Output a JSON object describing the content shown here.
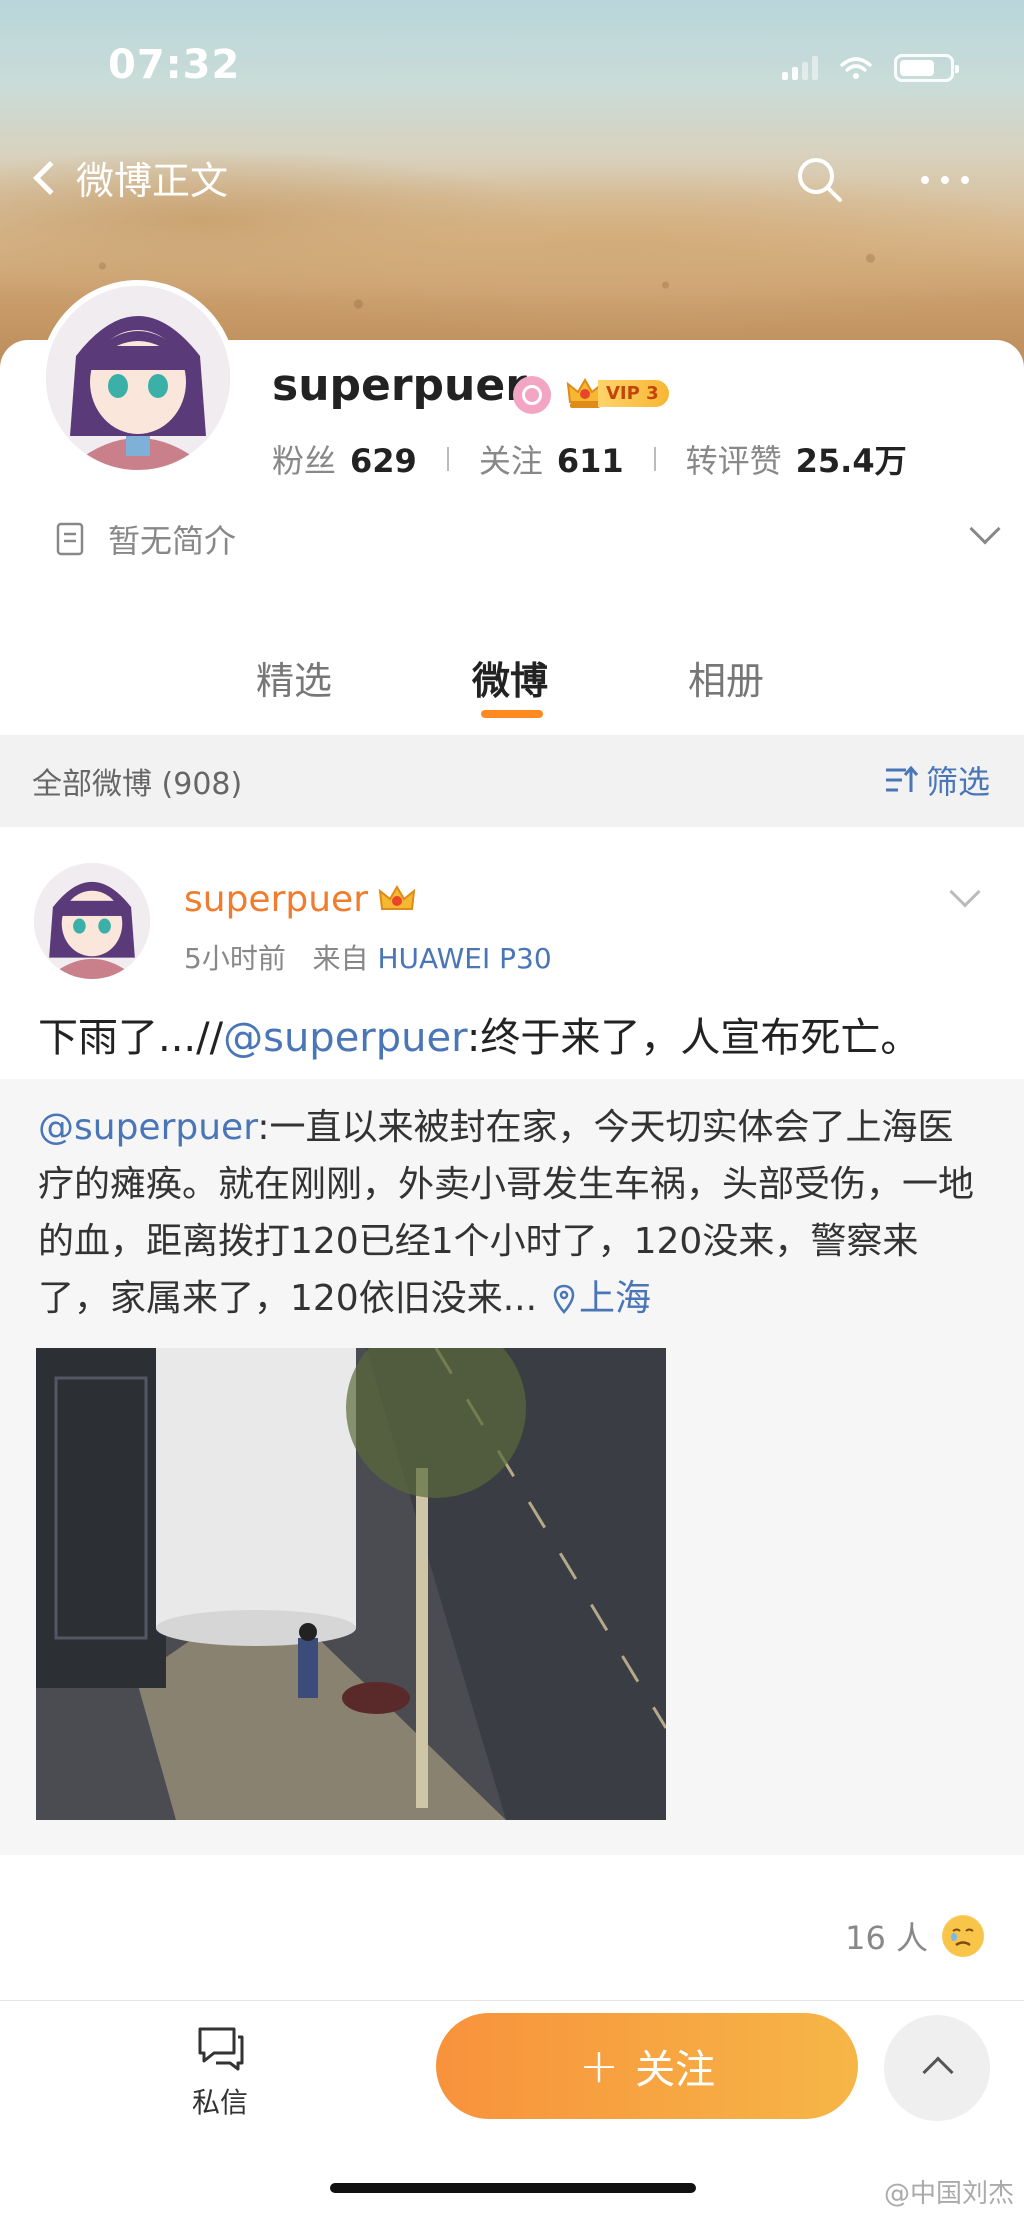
{
  "status_bar": {
    "time": "07:32",
    "battery_level": 0.7
  },
  "nav": {
    "back_label": "微博正文"
  },
  "profile": {
    "username": "superpuer",
    "vip_label": "VIP 3",
    "followers_label": "粉丝",
    "followers": "629",
    "following_label": "关注",
    "following": "611",
    "engagement_label": "转评赞",
    "engagement": "25.4万",
    "bio": "暂无简介"
  },
  "tabs": [
    {
      "label": "精选",
      "active": false
    },
    {
      "label": "微博",
      "active": true
    },
    {
      "label": "相册",
      "active": false
    }
  ],
  "filter": {
    "label": "全部微博 (908)",
    "button_label": "筛选"
  },
  "post": {
    "username": "superpuer",
    "time": "5小时前",
    "from_label": "来自",
    "device": "HUAWEI P30",
    "text_prefix": "下雨了...//",
    "text_mention": "@superpuer",
    "text_suffix": ":终于来了，人宣布死亡。",
    "repost_mention": "@superpuer",
    "repost_body": ":一直以来被封在家，今天切实体会了上海医疗的瘫痪。就在刚刚，外卖小哥发生车祸，头部受伤，一地的血，距离拨打120已经1个小时了，120没来，警察来了，家属来了，120依旧没来...",
    "location": "上海",
    "reactions_label": "16 人"
  },
  "bottom_bar": {
    "dm_label": "私信",
    "follow_plus": "+",
    "follow_label": "关注"
  },
  "watermark": "@中国刘杰",
  "colors": {
    "accent_orange": "#f8923c",
    "username_orange": "#f07c2e",
    "link_blue": "#4a76b8"
  }
}
